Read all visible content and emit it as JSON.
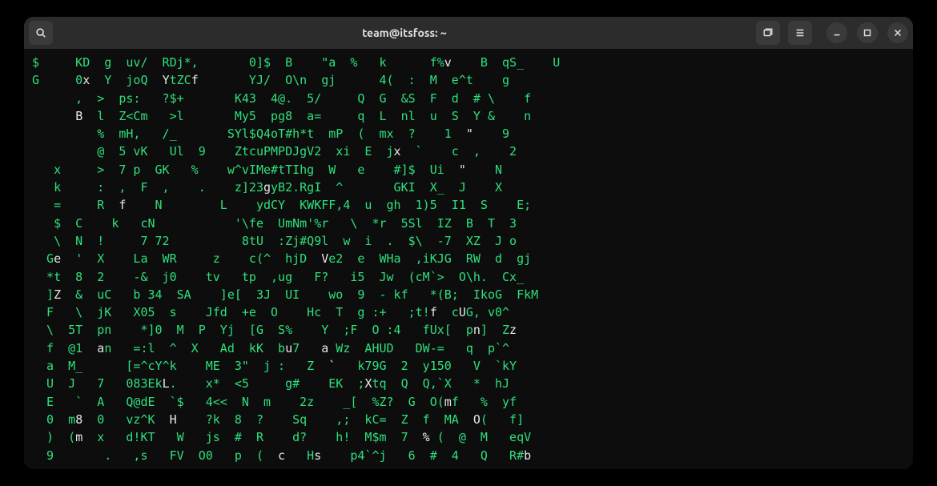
{
  "window": {
    "title": "team@itsfoss: ~"
  },
  "matrix": {
    "lines": [
      [
        [
          "g",
          "$     KD  g  uv/  RDj*,       0]$  B    \"a  %   k      f%"
        ],
        [
          "w",
          "v"
        ],
        [
          "g",
          "    B  qS_    U"
        ]
      ],
      [
        [
          "g",
          "G     0"
        ],
        [
          "w",
          "x"
        ],
        [
          "g",
          "  Y  joQ  "
        ],
        [
          "w",
          "Y"
        ],
        [
          "g",
          "tZC"
        ],
        [
          "w",
          "f"
        ],
        [
          "g",
          "       YJ/  O\\n  gj      4(  :  M  e^t    g"
        ]
      ],
      [
        [
          "g",
          "      ,  >  ps:   ?$+       K43  4@.  5/     Q  G  &S  F  d  # \\    f"
        ]
      ],
      [
        [
          "g",
          "      "
        ],
        [
          "w",
          "B"
        ],
        [
          "g",
          "  l  Z<Cm   >l       My5  pg8  a=     q  L  nl  u  S  Y &    n"
        ]
      ],
      [
        [
          "g",
          "         %  mH,   /_       SYl$Q4oT#h*t  mP  (  mx  ?    1  "
        ],
        [
          "w",
          "\""
        ],
        [
          "g",
          "    9"
        ]
      ],
      [
        [
          "g",
          "         @  5 vK   Ul  9    ZtcuPMPDJgV2  xi  E  j"
        ],
        [
          "w",
          "x"
        ],
        [
          "g",
          "  `    c  ,    2"
        ]
      ],
      [
        [
          "g",
          "   x     >  7 p  GK   %    w^vIMe#tTIhg  W   e    #]$  Ui  "
        ],
        [
          "w",
          "\""
        ],
        [
          "g",
          "    N"
        ]
      ],
      [
        [
          "g",
          "   k     :  ,  F  ,    .    z]23"
        ],
        [
          "w",
          "g"
        ],
        [
          "g",
          "yB2.RgI  ^       GKI  X_  J    X"
        ]
      ],
      [
        [
          "g",
          "   =     R  "
        ],
        [
          "w",
          "f"
        ],
        [
          "g",
          "    N        L    ydCY  KWKFF,4  u  gh  1)5  I1  S    E;"
        ]
      ],
      [
        [
          "g",
          "   $  C    k   cN           '\\fe  UmNm'%r   \\  *r  5Sl  IZ  B  T  3"
        ]
      ],
      [
        [
          "g",
          "   \\  N  !     7 72          8tU  :Zj#Q9l  w  i  .  $\\  -7  XZ  J o"
        ]
      ],
      [
        [
          "g",
          "  G"
        ],
        [
          "w",
          "e"
        ],
        [
          "g",
          "  '  X    La  WR     z    c(^  hjD  "
        ],
        [
          "w",
          "V"
        ],
        [
          "g",
          "e2  e  WHa  ,iKJG  RW  d  gj"
        ]
      ],
      [
        [
          "g",
          "  *t  8  2    -&  j0    tv   tp  ,ug   F?   i5  Jw  (cM`>  O\\h.  Cx_"
        ]
      ],
      [
        [
          "g",
          "  ]"
        ],
        [
          "w",
          "Z"
        ],
        [
          "g",
          "  &  uC   b 34  SA    ]e[  3J  UI    wo  9  - kf   *(B;  IkoG  FkM"
        ]
      ],
      [
        [
          "g",
          "  F   \\  jK   X05  s    Jfd  +e  O    Hc  T  g :+   ;t!"
        ],
        [
          "w",
          "f"
        ],
        [
          "g",
          "  c"
        ],
        [
          "w",
          "U"
        ],
        [
          "g",
          "G, v0^"
        ]
      ],
      [
        [
          "g",
          "  \\  5T  pn    *]0  M  P  Yj  [G  S%    Y  ;F  O :4   fUx[  p"
        ],
        [
          "w",
          "n"
        ],
        [
          "g",
          "]  Z"
        ],
        [
          "w",
          "z"
        ]
      ],
      [
        [
          "g",
          "  f  @1  "
        ],
        [
          "w",
          "a"
        ],
        [
          "g",
          "n   =:l  ^  X   Ad  kK  b"
        ],
        [
          "w",
          "u"
        ],
        [
          "g",
          "7   "
        ],
        [
          "w",
          "a"
        ],
        [
          "g",
          " Wz  AHUD   DW-=   q  p`^"
        ]
      ],
      [
        [
          "g",
          "  a  M_      [=^cY^k    ME  3\"  j :   Z  "
        ],
        [
          "w",
          "`"
        ],
        [
          "g",
          "   k79G  2  y150   V  `kY"
        ]
      ],
      [
        [
          "g",
          "  U  J   7   083Ek"
        ],
        [
          "w",
          "L"
        ],
        [
          "g",
          ".    x*  <5     g#    EK  ;"
        ],
        [
          "w",
          "X"
        ],
        [
          "g",
          "tq  Q  Q,`X   *  hJ"
        ]
      ],
      [
        [
          "g",
          "  E   `  A   Q@dE  `$   4<<  N  m    2z    _[  %Z?  G  O("
        ],
        [
          "w",
          "m"
        ],
        [
          "g",
          "f   %  yf"
        ]
      ],
      [
        [
          "g",
          "  0  m"
        ],
        [
          "w",
          "8"
        ],
        [
          "g",
          "  0   vz^K  "
        ],
        [
          "w",
          "H"
        ],
        [
          "g",
          "    ?k  8  ?    Sq    ,;  kC=  Z  f  MA  "
        ],
        [
          "w",
          "O"
        ],
        [
          "g",
          "(   f]"
        ]
      ],
      [
        [
          "g",
          "  )  ("
        ],
        [
          "w",
          "m"
        ],
        [
          "g",
          "  x   d!KT   W   js  #  R    d?    h!  M$m  7  "
        ],
        [
          "w",
          "%"
        ],
        [
          "g",
          " (  @  M   eqV"
        ]
      ],
      [
        [
          "g",
          "  9       .   ,s   FV  O0   p  (  "
        ],
        [
          "w",
          "c"
        ],
        [
          "g",
          "   H"
        ],
        [
          "w",
          "s"
        ],
        [
          "g",
          "    p4`^j   6  #  4   Q   R#"
        ],
        [
          "w",
          "b"
        ]
      ]
    ]
  }
}
